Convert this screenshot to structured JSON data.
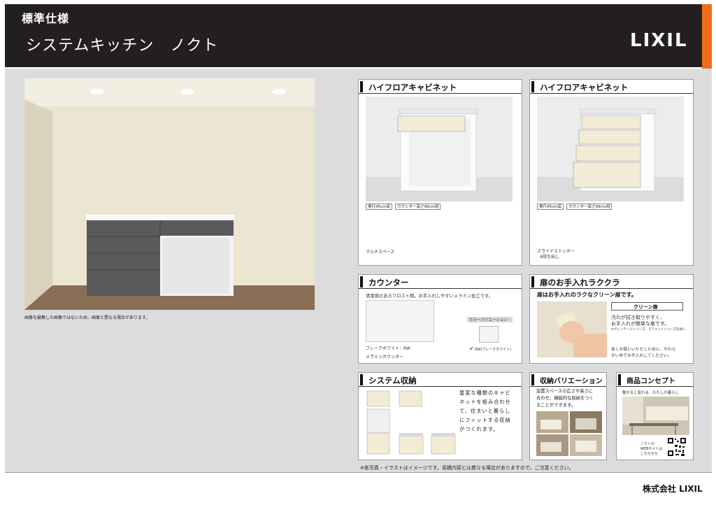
{
  "header": {
    "title": "標準仕様",
    "subtitle": "システムキッチン　ノクト",
    "logo": "LIXIL"
  },
  "colors": {
    "header_bg": "#231f1f",
    "accent": "#ef6c18",
    "panel_bg": "#dcdcdc"
  },
  "main": {
    "photo_note": "画像を編集した画像ではないため、画像と異なる場合があります。"
  },
  "cards": {
    "cabinet1": {
      "title": "ハイフロアキャビネット",
      "tags": [
        "奥行45cm高",
        "カウンター高さ99cm用"
      ],
      "caption": "マルチスペース"
    },
    "cabinet2": {
      "title": "ハイフロアキャビネット",
      "tags": [
        "奥行45cm高",
        "カウンター高さ99cm用"
      ],
      "caption1": "スライドストッカー",
      "caption2": "4段引出し"
    },
    "counter": {
      "title": "カウンター",
      "desc": "清潔感のあるフロスト柄。お手入れしやすいメラミン加工です。",
      "swatch_label": "フレークホワイト：RW",
      "material": "メラミンカウンター",
      "variation_title": "カラーバリエーション",
      "variation_item": "RW(フレークホワイト)"
    },
    "door": {
      "title": "扉のお手入れラククラ",
      "lead": "扉はお手入れのラクなクリーン扉です。",
      "badge": "クリーン扉",
      "line1": "汚れが拭き取りやすく、",
      "line2": "お手入れが簡単な扉です。",
      "note": "※ヴィンテージシリーズ、ラファットシリーズを除く",
      "bottom1": "長くお使いいただくために、やわら",
      "bottom2": "かい布でお手入れしてください。"
    },
    "system": {
      "title": "システム収納",
      "lines": [
        "豊富な種類のキャビ",
        "ネットを組み合わせ",
        "て、住まいと暮らし",
        "にフィットする収納",
        "がつくれます。"
      ]
    },
    "variation": {
      "title": "収納バリエーション",
      "lines": [
        "設置スペースの広さや高さに",
        "合わせ、機能的な収納をつく",
        "ることができます。"
      ]
    },
    "concept": {
      "title": "商品コンセプト",
      "tagline": "魅せると変わる、わたしの暮らし",
      "qr1": "ノクトの",
      "qr2": "WEBサイトは",
      "qr3": "こちらから"
    }
  },
  "footer": {
    "note": "※各写真・イラストはイメージです。見積内容とは異なる場合がありますので、ご注意ください。",
    "company": "株式会社 LIXIL"
  }
}
